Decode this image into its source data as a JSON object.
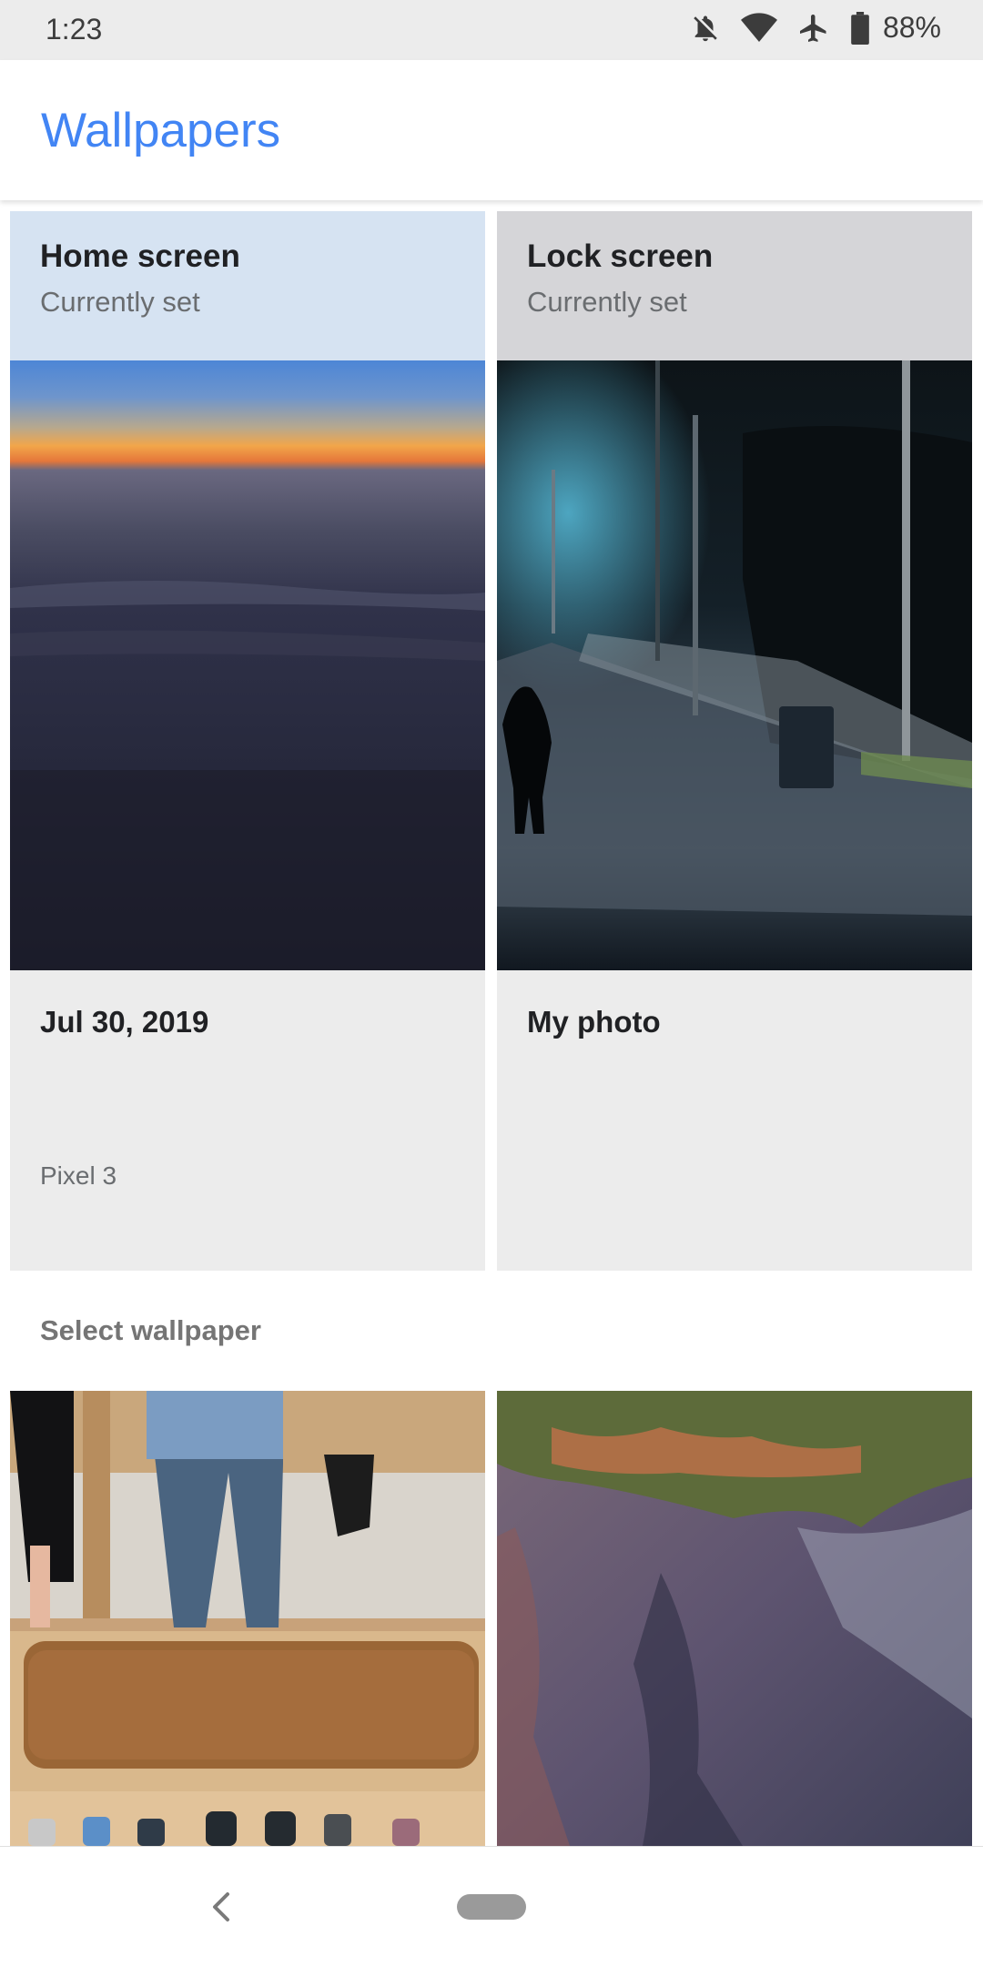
{
  "status_bar": {
    "time": "1:23",
    "battery": "88%",
    "icons": [
      "notifications-off-icon",
      "wifi-icon",
      "airplane-icon",
      "battery-icon"
    ]
  },
  "app_bar": {
    "title": "Wallpapers",
    "title_color": "#4285f4"
  },
  "current": {
    "home": {
      "title": "Home screen",
      "subtitle": "Currently set",
      "name": "Jul 30, 2019",
      "attribution": "Pixel 3"
    },
    "lock": {
      "title": "Lock screen",
      "subtitle": "Currently set",
      "name": "My photo"
    }
  },
  "section": {
    "label": "Select wallpaper"
  },
  "nav": {
    "icons": [
      "back-icon",
      "home-pill"
    ]
  }
}
